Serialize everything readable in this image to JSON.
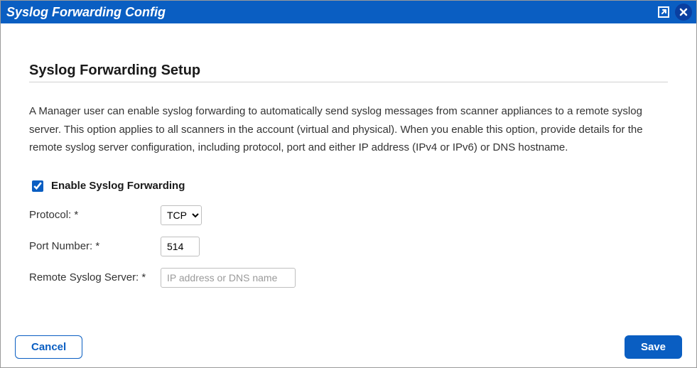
{
  "header": {
    "title": "Syslog Forwarding Config"
  },
  "section": {
    "title": "Syslog Forwarding Setup",
    "description": "A Manager user can enable syslog forwarding to automatically send syslog messages from scanner appliances to a remote syslog server. This option applies to all scanners in the account (virtual and physical). When you enable this option, provide details for the remote syslog server configuration, including protocol, port and either IP address (IPv4 or IPv6) or DNS hostname."
  },
  "form": {
    "enable_label": "Enable Syslog Forwarding",
    "enable_checked": true,
    "protocol_label": "Protocol: *",
    "protocol_value": "TCP",
    "port_label": "Port Number: *",
    "port_value": "514",
    "server_label": "Remote Syslog Server: *",
    "server_placeholder": "IP address or DNS name",
    "server_value": ""
  },
  "buttons": {
    "cancel": "Cancel",
    "save": "Save"
  }
}
